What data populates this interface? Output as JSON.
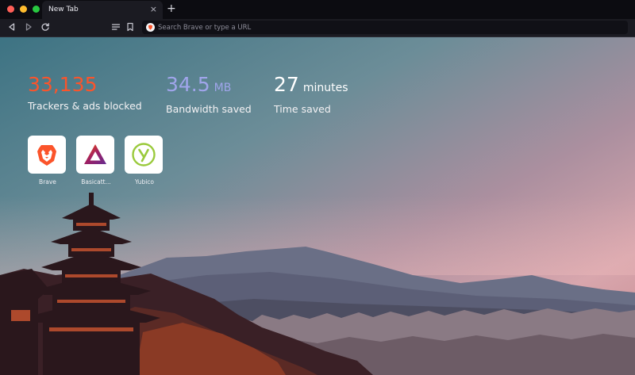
{
  "window": {
    "controls": {
      "close_color": "#ff5f57",
      "minimize_color": "#febc2e",
      "zoom_color": "#28c840"
    }
  },
  "tabs": [
    {
      "title": "New Tab",
      "active": true
    }
  ],
  "new_tab_symbol": "+",
  "close_symbol": "×",
  "toolbar": {
    "back_icon": "back-arrow-icon",
    "forward_icon": "forward-arrow-icon",
    "reload_icon": "reload-icon",
    "reader_icon": "reader-mode-icon",
    "bookmark_icon": "bookmark-icon"
  },
  "urlbar": {
    "placeholder": "Search Brave or type a URL",
    "value": "",
    "shield_icon": "brave-shield-icon"
  },
  "stats": [
    {
      "value": "33,135",
      "unit": "",
      "label": "Trackers & ads blocked",
      "color": "#fb542b"
    },
    {
      "value": "34.5",
      "unit": "MB",
      "label": "Bandwidth saved",
      "color": "#a0a5eb"
    },
    {
      "value": "27",
      "unit": "minutes",
      "label": "Time saved",
      "color": "#ffffff"
    }
  ],
  "top_sites": [
    {
      "label": "Brave",
      "icon": "brave-lion-icon"
    },
    {
      "label": "Basicatt...",
      "icon": "bat-triangle-icon"
    },
    {
      "label": "Yubico",
      "icon": "yubico-icon"
    }
  ],
  "background": {
    "description_colors": {
      "sky_top": "#4b7f8d",
      "sky_mid": "#a7919f",
      "horizon": "#e2afb2"
    }
  }
}
